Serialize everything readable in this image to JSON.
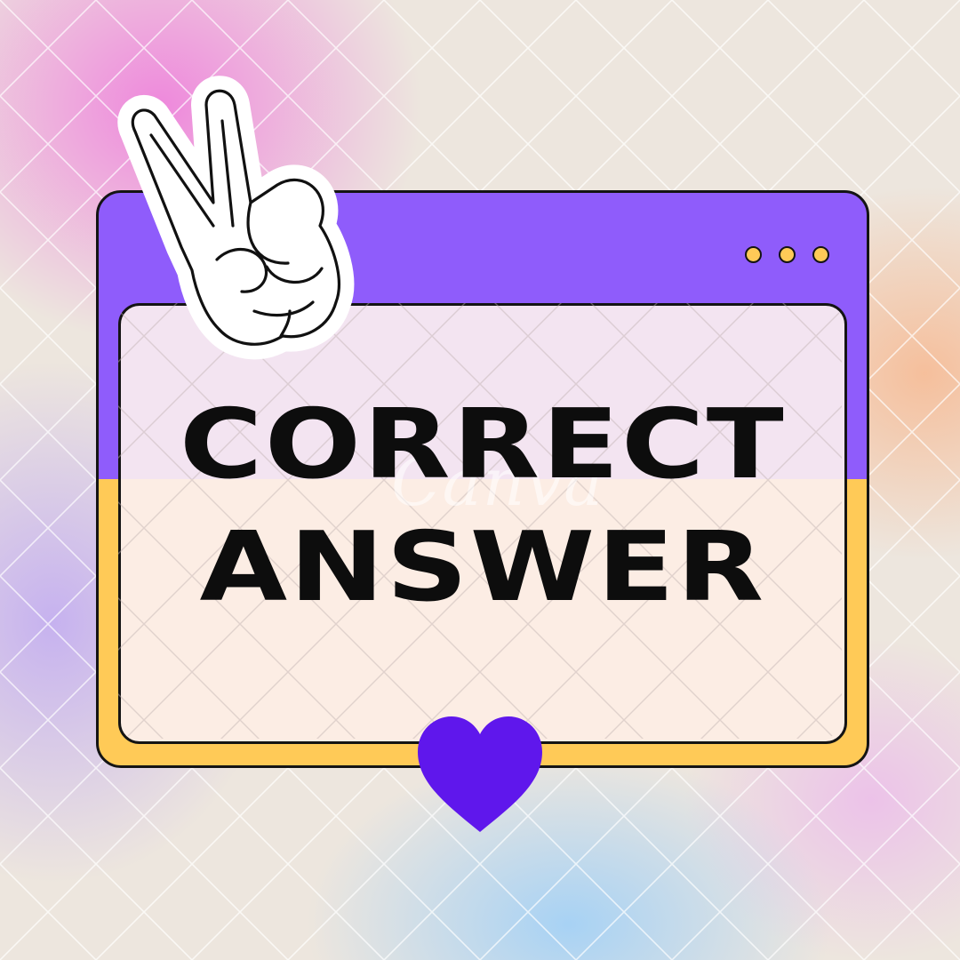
{
  "headline": {
    "line1": "CORRECT",
    "line2": "ANSWER"
  },
  "watermark": "Canva",
  "colors": {
    "titlebar": "#8f5cfb",
    "window_bottom": "#ffca57",
    "panel": "#fcf0f0",
    "heart": "#5f17ec",
    "outline": "#141414"
  },
  "icons": {
    "sticker": "peace-hand-icon",
    "badge": "heart-icon",
    "window_controls": "three-dots-icon"
  }
}
